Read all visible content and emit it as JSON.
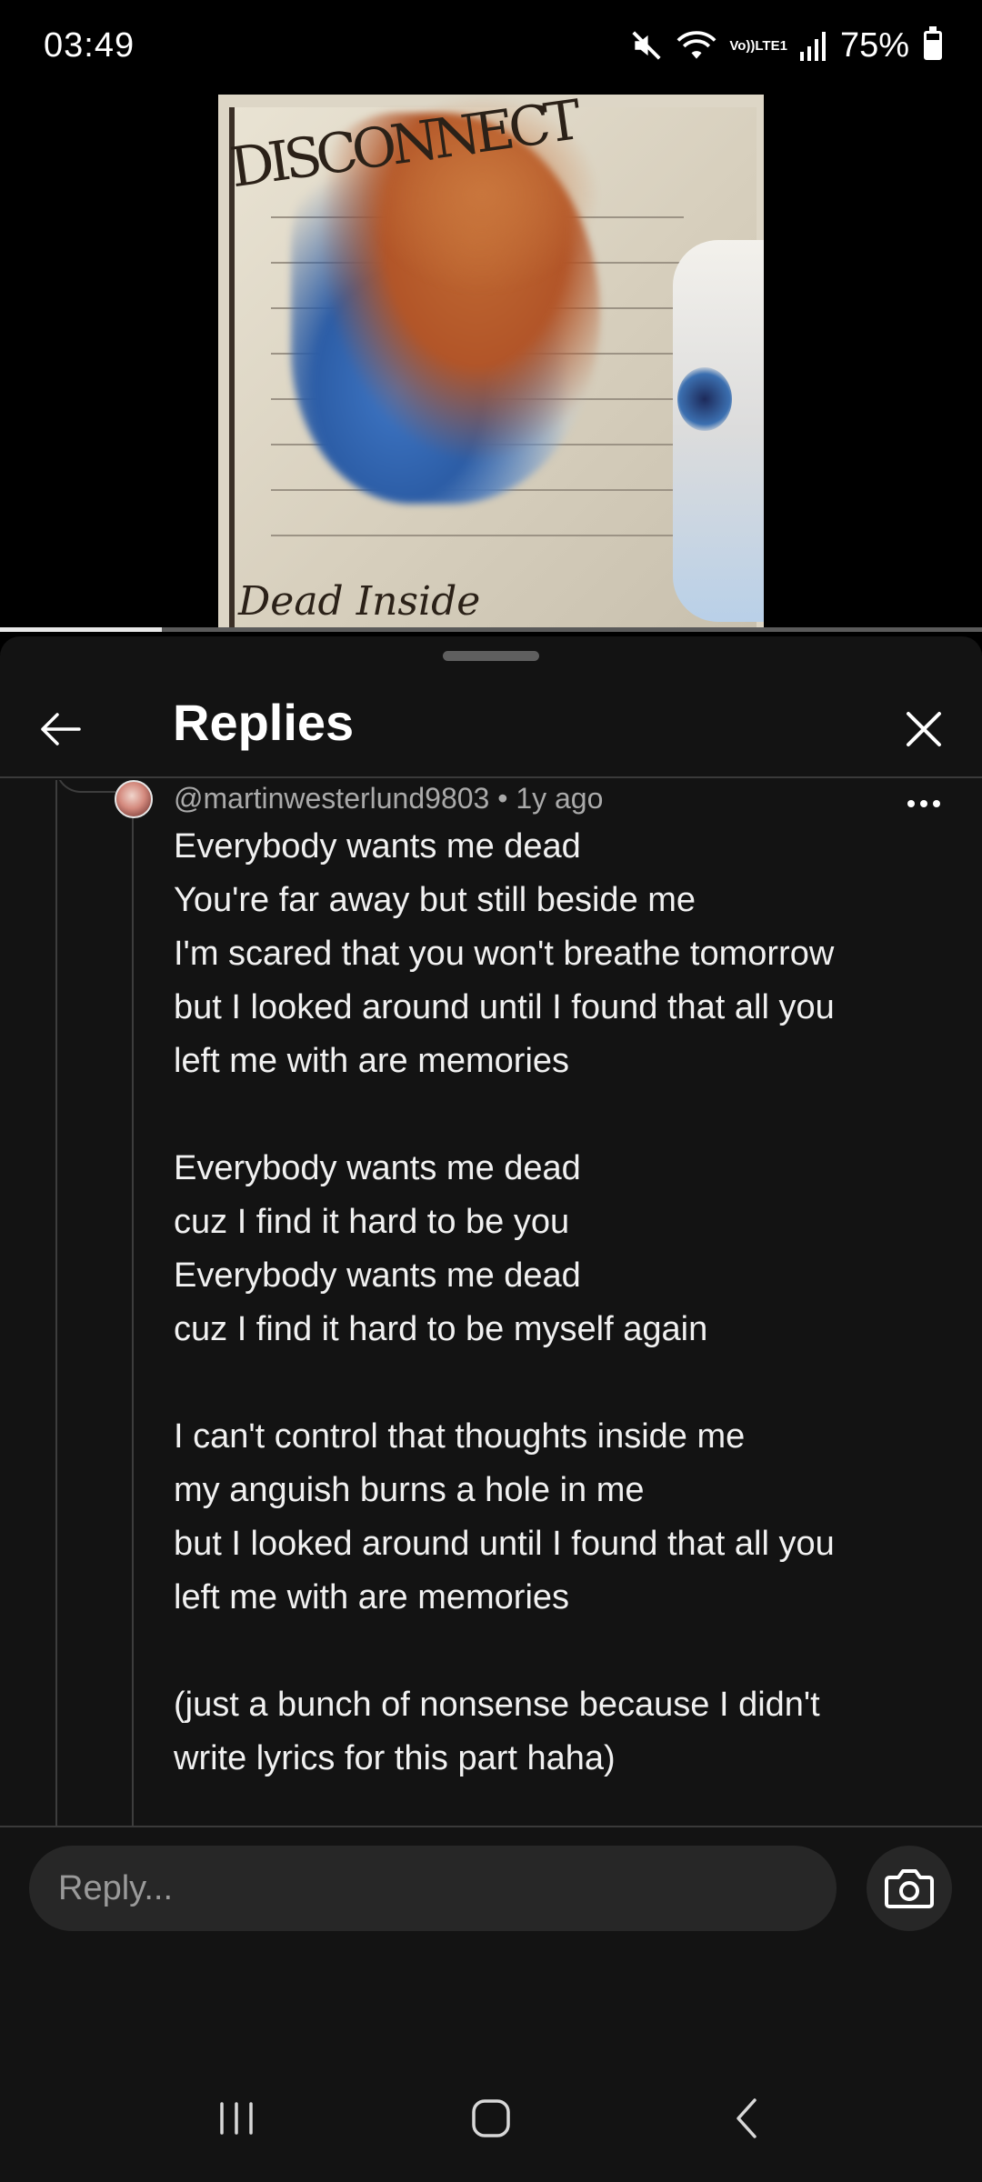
{
  "status_bar": {
    "time": "03:49",
    "network_label_top": "Vo))",
    "network_label_bottom": "LTE1",
    "battery": "75%",
    "battery_level": 0.75
  },
  "video": {
    "album_logo": "DISCONNECT",
    "album_title": "Dead Inside",
    "progress": 0.165
  },
  "sheet": {
    "title": "Replies"
  },
  "comment": {
    "author": "@martinwesterlund9803",
    "separator": " • ",
    "age": "1y ago",
    "text": "Everybody wants me dead\nYou're far away but still beside me\nI'm scared that you won't breathe tomorrow\nbut I looked around until I found that all you\nleft me with are memories\n\nEverybody wants me dead\ncuz I find it hard to be you\nEverybody wants me dead\ncuz I find it hard to be myself again\n\nI can't control that thoughts inside me\nmy anguish burns a hole in me\nbut I looked around until I found that all you\nleft me with are memories\n\n(just a bunch of nonsense because I didn't\nwrite lyrics for this part haha)"
  },
  "reply_box": {
    "placeholder": "Reply..."
  },
  "icons": {
    "mute": "mute-icon",
    "wifi": "wifi-icon",
    "signal": "signal-icon",
    "battery": "battery-icon",
    "back": "arrow-left-icon",
    "close": "close-icon",
    "more": "more-vert-icon",
    "camera": "camera-icon",
    "recents": "recents-icon",
    "home": "home-icon",
    "nav_back": "chevron-left-icon"
  }
}
